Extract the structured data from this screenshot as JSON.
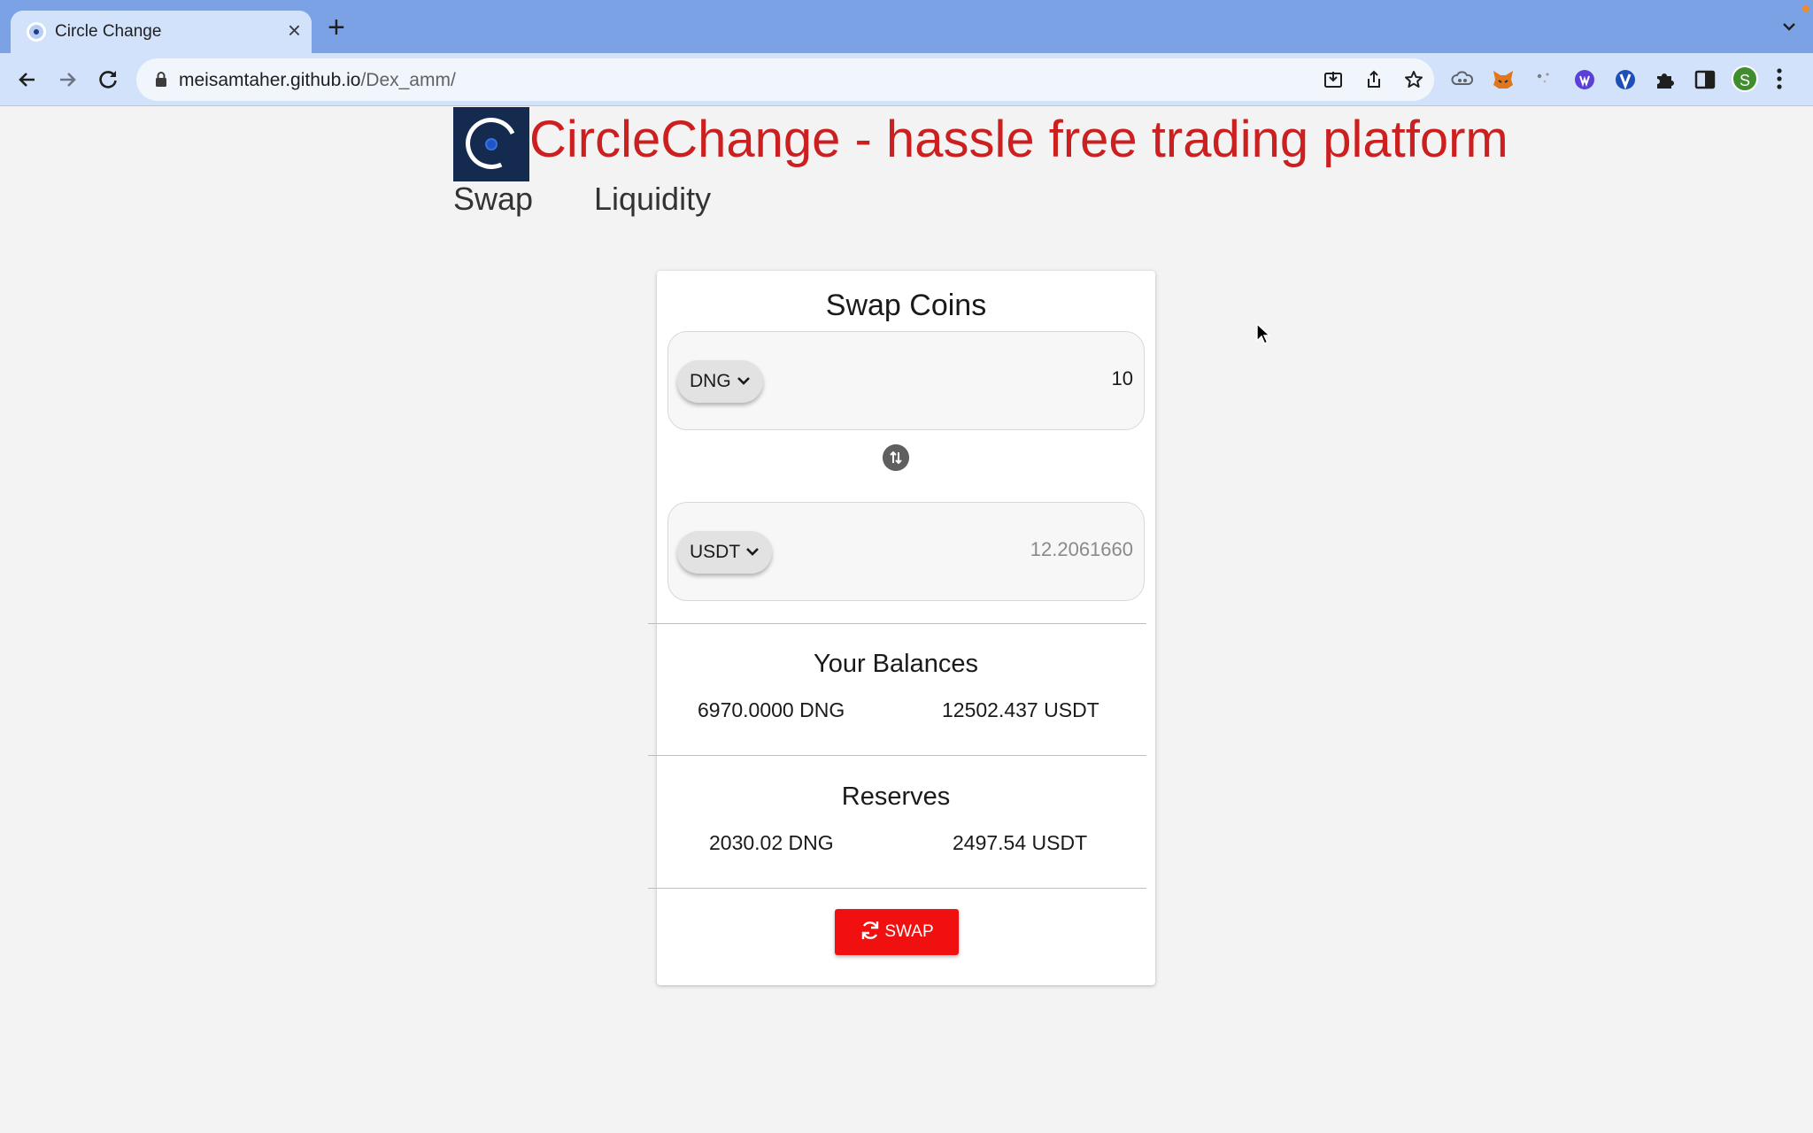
{
  "browser": {
    "tab_title": "Circle Change",
    "url_host": "meisamtaher.github.io",
    "url_path": "/Dex_amm/",
    "profile_initial": "S"
  },
  "page": {
    "site_title": "CircleChange - hassle free trading platform",
    "nav": {
      "swap": "Swap",
      "liquidity": "Liquidity"
    },
    "card": {
      "title": "Swap Coins",
      "from": {
        "symbol": "DNG",
        "amount": "10"
      },
      "to": {
        "symbol": "USDT",
        "amount": "12.2061660"
      },
      "balances": {
        "title": "Your Balances",
        "dng": "6970.0000 DNG",
        "usdt": "12502.437 USDT"
      },
      "reserves": {
        "title": "Reserves",
        "dng": "2030.02 DNG",
        "usdt": "2497.54 USDT"
      },
      "swap_button": "SWAP"
    }
  },
  "colors": {
    "title_red": "#cc1f1f",
    "swap_button": "#f01010",
    "tab_strip": "#7aa2e4"
  }
}
